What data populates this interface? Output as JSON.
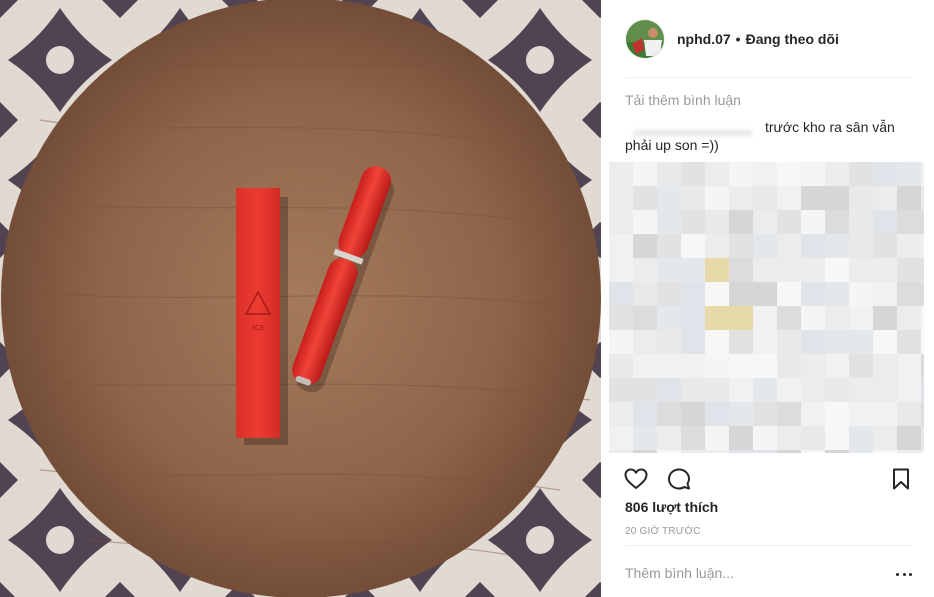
{
  "photo": {
    "icon": "lipstick-photo",
    "tube_brand_mark": "3CE"
  },
  "post": {
    "username": "nphd.07",
    "separator": "•",
    "follow_state": "Đang theo dõi",
    "load_more_comments": "Tải thêm bình luận",
    "comment": {
      "text_line_1": "trước kho ra sân vẫn",
      "text_line_2": "phải up son =))"
    },
    "likes": "806 lượt thích",
    "time_ago": "20 GIỜ TRƯỚC",
    "add_comment_placeholder": "Thêm bình luận..."
  },
  "icons": {
    "like": "heart-icon",
    "comment": "speech-bubble-icon",
    "save": "bookmark-icon",
    "more": "more-dots-icon"
  },
  "colors": {
    "product_red": "#e8322c",
    "text_primary": "#262626",
    "text_secondary": "#999999"
  }
}
